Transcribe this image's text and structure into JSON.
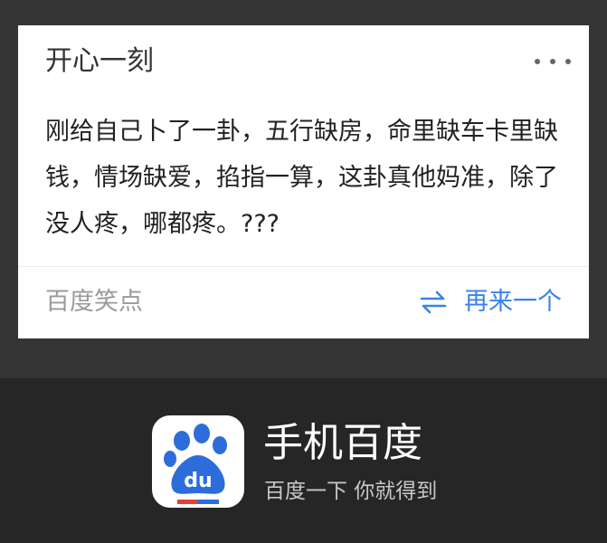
{
  "card": {
    "title": "开心一刻",
    "content": "刚给自己卜了一卦，五行缺房，命里缺车卡里缺钱，情场缺爱，掐指一算，这卦真他妈准，除了没人疼，哪都疼。???",
    "source": "百度笑点",
    "refresh_label": "再来一个",
    "more_icon": "more-dots-icon",
    "refresh_icon": "swap-arrows-icon"
  },
  "promo": {
    "app_name": "手机百度",
    "slogan": "百度一下 你就得到",
    "logo_icon": "baidu-paw-logo"
  },
  "colors": {
    "page_bg": "#353535",
    "footer_bg": "#262626",
    "card_bg": "#ffffff",
    "link_blue": "#3a82e6",
    "logo_blue": "#2d6ddb"
  }
}
